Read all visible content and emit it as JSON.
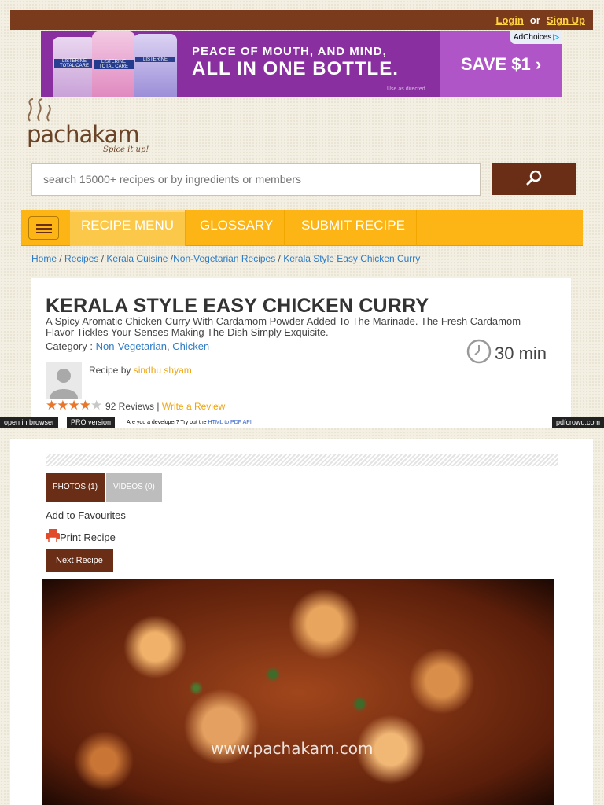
{
  "header": {
    "login_label": "Login",
    "or_label": "or",
    "signup_label": "Sign Up"
  },
  "ad": {
    "adchoices_label": "AdChoices",
    "headline_line1": "PEACE OF MOUTH, AND MIND,",
    "headline_line2": "ALL IN ONE BOTTLE.",
    "small_print": "Use as directed",
    "cta_label": "SAVE $1 ›",
    "bottle_labels": [
      "LISTERINE TOTAL CARE",
      "LISTERINE TOTAL CARE",
      "LISTERINE"
    ]
  },
  "logo": {
    "name": "pachakam",
    "tagline": "Spice it up!"
  },
  "search": {
    "placeholder": "search 15000+ recipes or by ingredients or members"
  },
  "nav": {
    "items": [
      {
        "label": "RECIPE MENU"
      },
      {
        "label": "GLOSSARY"
      },
      {
        "label": "SUBMIT RECIPE"
      }
    ]
  },
  "breadcrumb": {
    "home": "Home",
    "recipes": "Recipes",
    "kerala": "Kerala Cuisine",
    "nonveg": "Non-Vegetarian Recipes",
    "current": "Kerala Style Easy Chicken Curry"
  },
  "recipe": {
    "title": "KERALA STYLE EASY CHICKEN CURRY",
    "description": "A Spicy Aromatic Chicken Curry With Cardamom Powder Added To The Marinade. The Fresh Cardamom Flavor Tickles Your Senses Making The Dish Simply Exquisite.",
    "category_label": "Category :",
    "category_1": "Non-Vegetarian",
    "category_2": "Chicken",
    "time": "30 min",
    "recipe_by_label": "Recipe by",
    "author": "sindhu shyam",
    "rating": 4,
    "rating_max": 5,
    "reviews_text": "92 Reviews |",
    "write_review": "Write a Review"
  },
  "pdfcrowd": {
    "open_browser": "open in browser",
    "pro": "PRO version",
    "dev_text": "Are you a developer? Try out the",
    "dev_link": "HTML to PDF API",
    "brand": "pdfcrowd.com"
  },
  "media": {
    "photos_tab": "PHOTOS (1)",
    "videos_tab": "VIDEOS (0)",
    "favourites": "Add to Favourites",
    "print": "Print Recipe",
    "next": "Next Recipe",
    "watermark": "www.pachakam.com"
  },
  "colors": {
    "brand_brown": "#6a2d15",
    "nav_orange": "#fdb515",
    "link_blue": "#2e7bc4",
    "link_orange": "#f0a30a"
  }
}
